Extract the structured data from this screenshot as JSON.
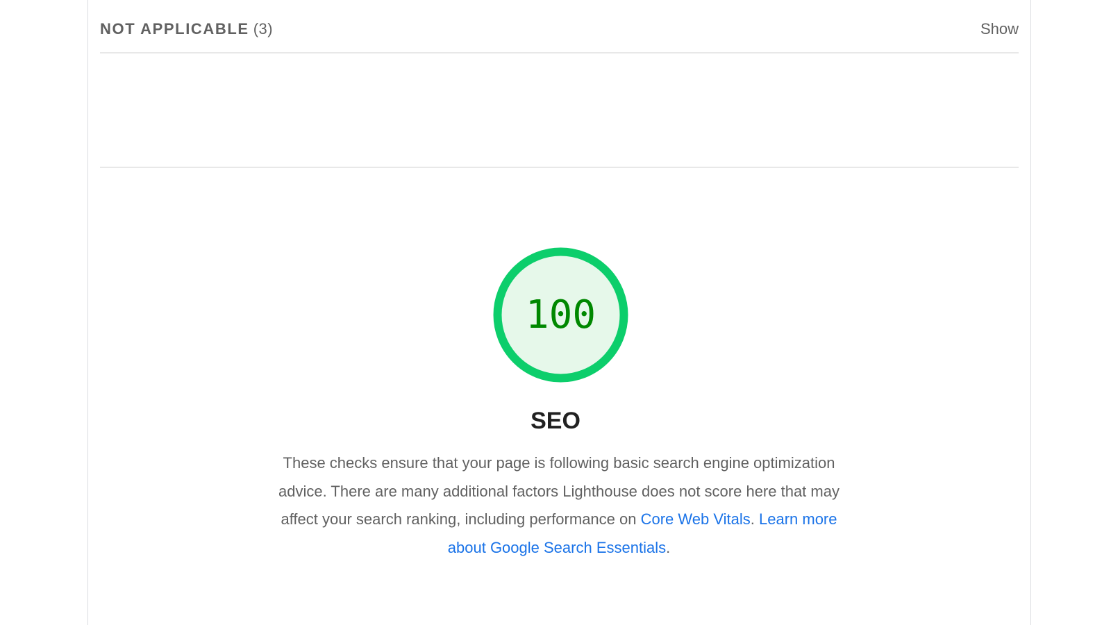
{
  "not_applicable": {
    "label": "NOT APPLICABLE",
    "count": "(3)",
    "toggle_label": "Show"
  },
  "seo": {
    "score": "100",
    "score_fraction": 1.0,
    "title": "SEO",
    "description_text": "These checks ensure that your page is following basic search engine optimization advice. There are many additional factors Lighthouse does not score here that may affect your search ranking, including performance on ",
    "link_core_web_vitals": "Core Web Vitals",
    "sep": ". ",
    "link_search_essentials": "Learn more about Google Search Essentials",
    "trailing": "."
  },
  "colors": {
    "pass_ring": "#0cce6b",
    "pass_fill": "#e6f8ea",
    "pass_text": "#008800",
    "link": "#1a73e8"
  }
}
